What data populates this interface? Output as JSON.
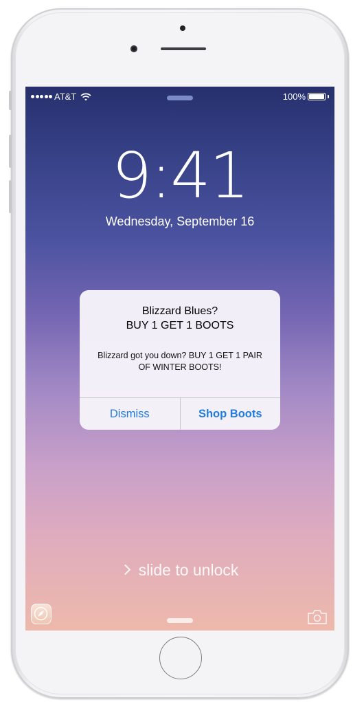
{
  "status_bar": {
    "carrier": "AT&T",
    "signal_bars": 5,
    "wifi_icon": "wifi-icon",
    "battery_percent": "100%",
    "battery_level": 1.0
  },
  "lock_screen": {
    "time": "9:41",
    "date": "Wednesday, September 16",
    "slide_text": "slide to unlock"
  },
  "alert": {
    "title_line1": "Blizzard Blues?",
    "title_line2": "BUY 1 GET 1 BOOTS",
    "message": "Blizzard got you down? BUY 1 GET 1 PAIR OF WINTER BOOTS!",
    "dismiss_label": "Dismiss",
    "action_label": "Shop Boots"
  },
  "icons": {
    "bottom_left": "safari-compass-icon",
    "bottom_right": "camera-icon"
  },
  "colors": {
    "accent": "#1f7bdc",
    "wallpaper_top": "#27306d",
    "wallpaper_bottom": "#eeb9ab"
  }
}
